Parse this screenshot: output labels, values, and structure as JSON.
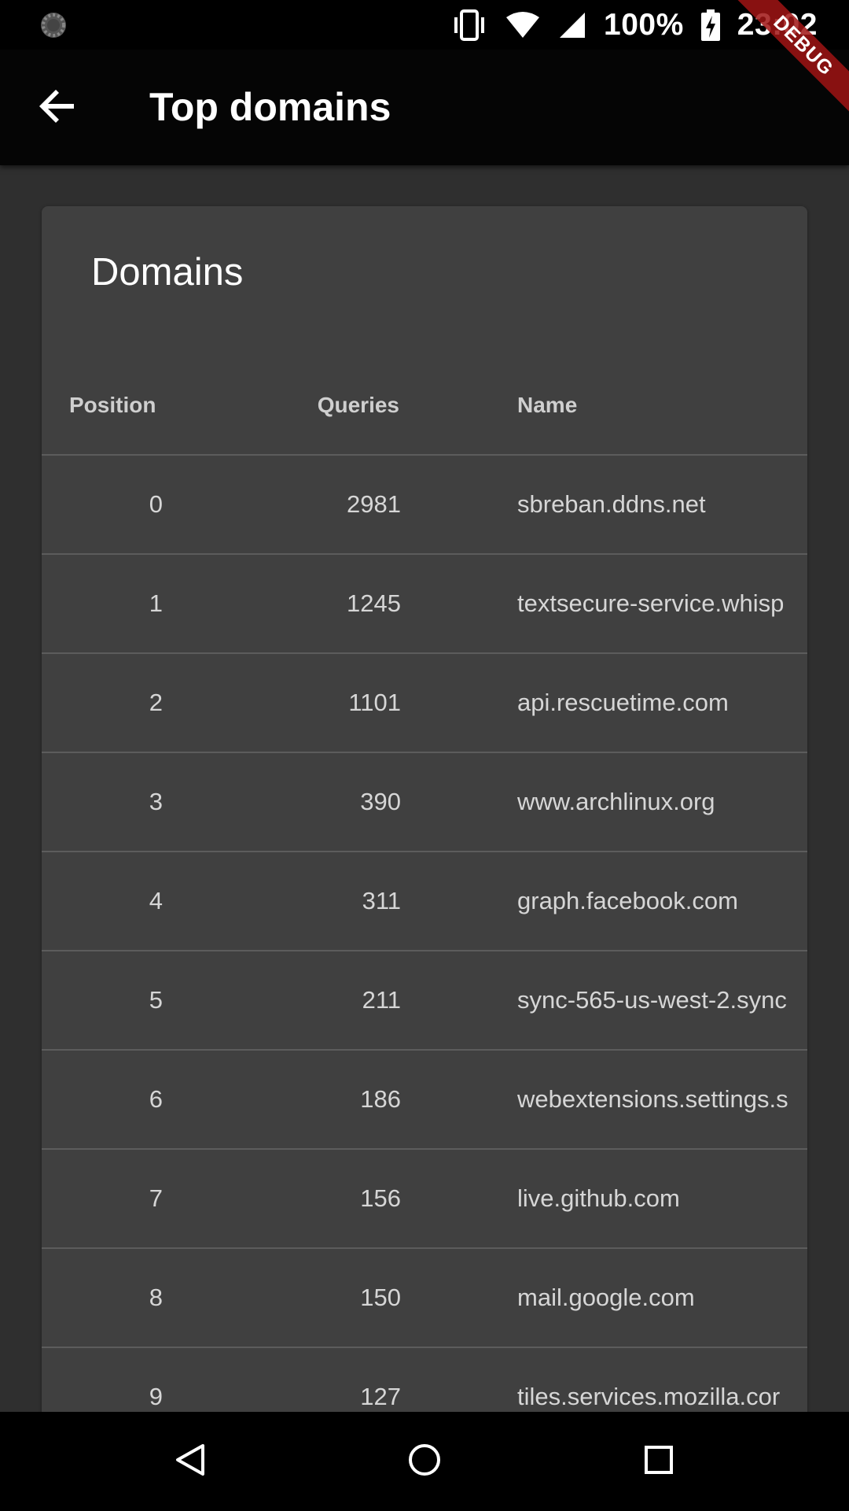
{
  "status_bar": {
    "battery_percent": "100%",
    "time": "23:02"
  },
  "debug_banner": "DEBUG",
  "app_bar": {
    "title": "Top domains"
  },
  "card": {
    "title": "Domains",
    "columns": [
      "Position",
      "Queries",
      "Name"
    ],
    "rows": [
      {
        "position": "0",
        "queries": "2981",
        "name": "sbreban.ddns.net"
      },
      {
        "position": "1",
        "queries": "1245",
        "name": "textsecure-service.whisp"
      },
      {
        "position": "2",
        "queries": "1101",
        "name": "api.rescuetime.com"
      },
      {
        "position": "3",
        "queries": "390",
        "name": "www.archlinux.org"
      },
      {
        "position": "4",
        "queries": "311",
        "name": "graph.facebook.com"
      },
      {
        "position": "5",
        "queries": "211",
        "name": "sync-565-us-west-2.sync"
      },
      {
        "position": "6",
        "queries": "186",
        "name": "webextensions.settings.s"
      },
      {
        "position": "7",
        "queries": "156",
        "name": "live.github.com"
      },
      {
        "position": "8",
        "queries": "150",
        "name": "mail.google.com"
      },
      {
        "position": "9",
        "queries": "127",
        "name": "tiles.services.mozilla.cor"
      }
    ]
  },
  "icons": {
    "status": [
      "loading-spinner-icon",
      "vibrate-icon",
      "wifi-icon",
      "cell-signal-icon",
      "battery-charging-icon"
    ],
    "app_bar": "arrow-back-icon",
    "nav": [
      "nav-back-icon",
      "nav-home-icon",
      "nav-recents-icon"
    ]
  }
}
